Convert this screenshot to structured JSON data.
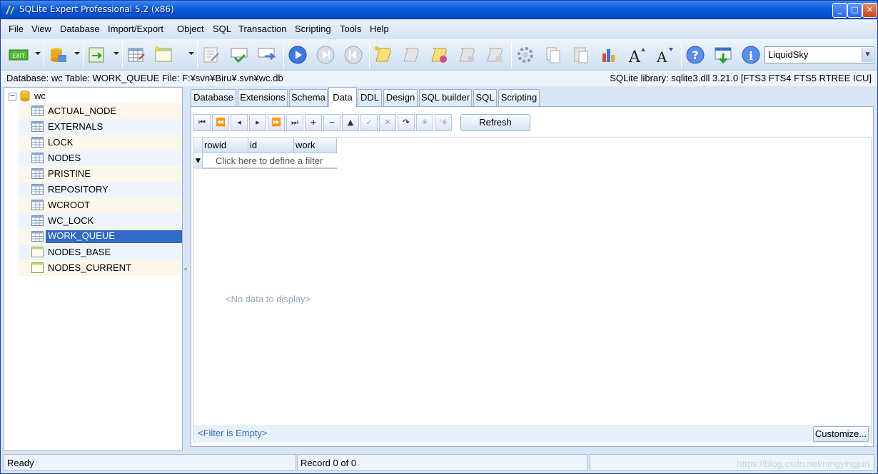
{
  "window": {
    "title": "SQLite Expert Professional 5.2 (x86)",
    "min": "_",
    "max": "□",
    "close": "✕"
  },
  "menu": [
    "File",
    "View",
    "Database",
    "Import/Export",
    "Object",
    "SQL",
    "Transaction",
    "Scripting",
    "Tools",
    "Help"
  ],
  "toolbar": {
    "exit_label": "EXIT",
    "skin": "LiquidSky"
  },
  "info": {
    "left": "Database: wc   Table: WORK_QUEUE   File: F:¥svn¥Biru¥.svn¥wc.db",
    "right": "SQLite library: sqlite3.dll 3.21.0 [FTS3 FTS4 FTS5 RTREE ICU]"
  },
  "tree": {
    "root": "wc",
    "expander": "−",
    "items": [
      {
        "label": "ACTUAL_NODE",
        "kind": "table"
      },
      {
        "label": "EXTERNALS",
        "kind": "table"
      },
      {
        "label": "LOCK",
        "kind": "table"
      },
      {
        "label": "NODES",
        "kind": "table"
      },
      {
        "label": "PRISTINE",
        "kind": "table"
      },
      {
        "label": "REPOSITORY",
        "kind": "table"
      },
      {
        "label": "WCROOT",
        "kind": "table"
      },
      {
        "label": "WC_LOCK",
        "kind": "table"
      },
      {
        "label": "WORK_QUEUE",
        "kind": "table",
        "selected": true
      },
      {
        "label": "NODES_BASE",
        "kind": "view"
      },
      {
        "label": "NODES_CURRENT",
        "kind": "view"
      }
    ]
  },
  "tabs": [
    "Database",
    "Extensions",
    "Schema",
    "Data",
    "DDL",
    "Design",
    "SQL builder",
    "SQL",
    "Scripting"
  ],
  "active_tab": "Data",
  "nav": {
    "buttons": [
      "⏮",
      "⏪",
      "◂",
      "▸",
      "⏩",
      "⏭",
      "+",
      "−",
      "▲",
      "✓",
      "✕",
      "↷",
      "✳",
      "'✳"
    ],
    "refresh": "Refresh"
  },
  "grid": {
    "columns": [
      "rowid",
      "id",
      "work"
    ],
    "filter_prompt": "Click here to define a filter",
    "empty": "<No data to display>",
    "filter_status": "<Filter is Empty>",
    "customize": "Customize..."
  },
  "status": {
    "left": "Ready",
    "record": "Record 0 of 0",
    "watermark": "https://blog.csdn.net/ningyingjun"
  }
}
